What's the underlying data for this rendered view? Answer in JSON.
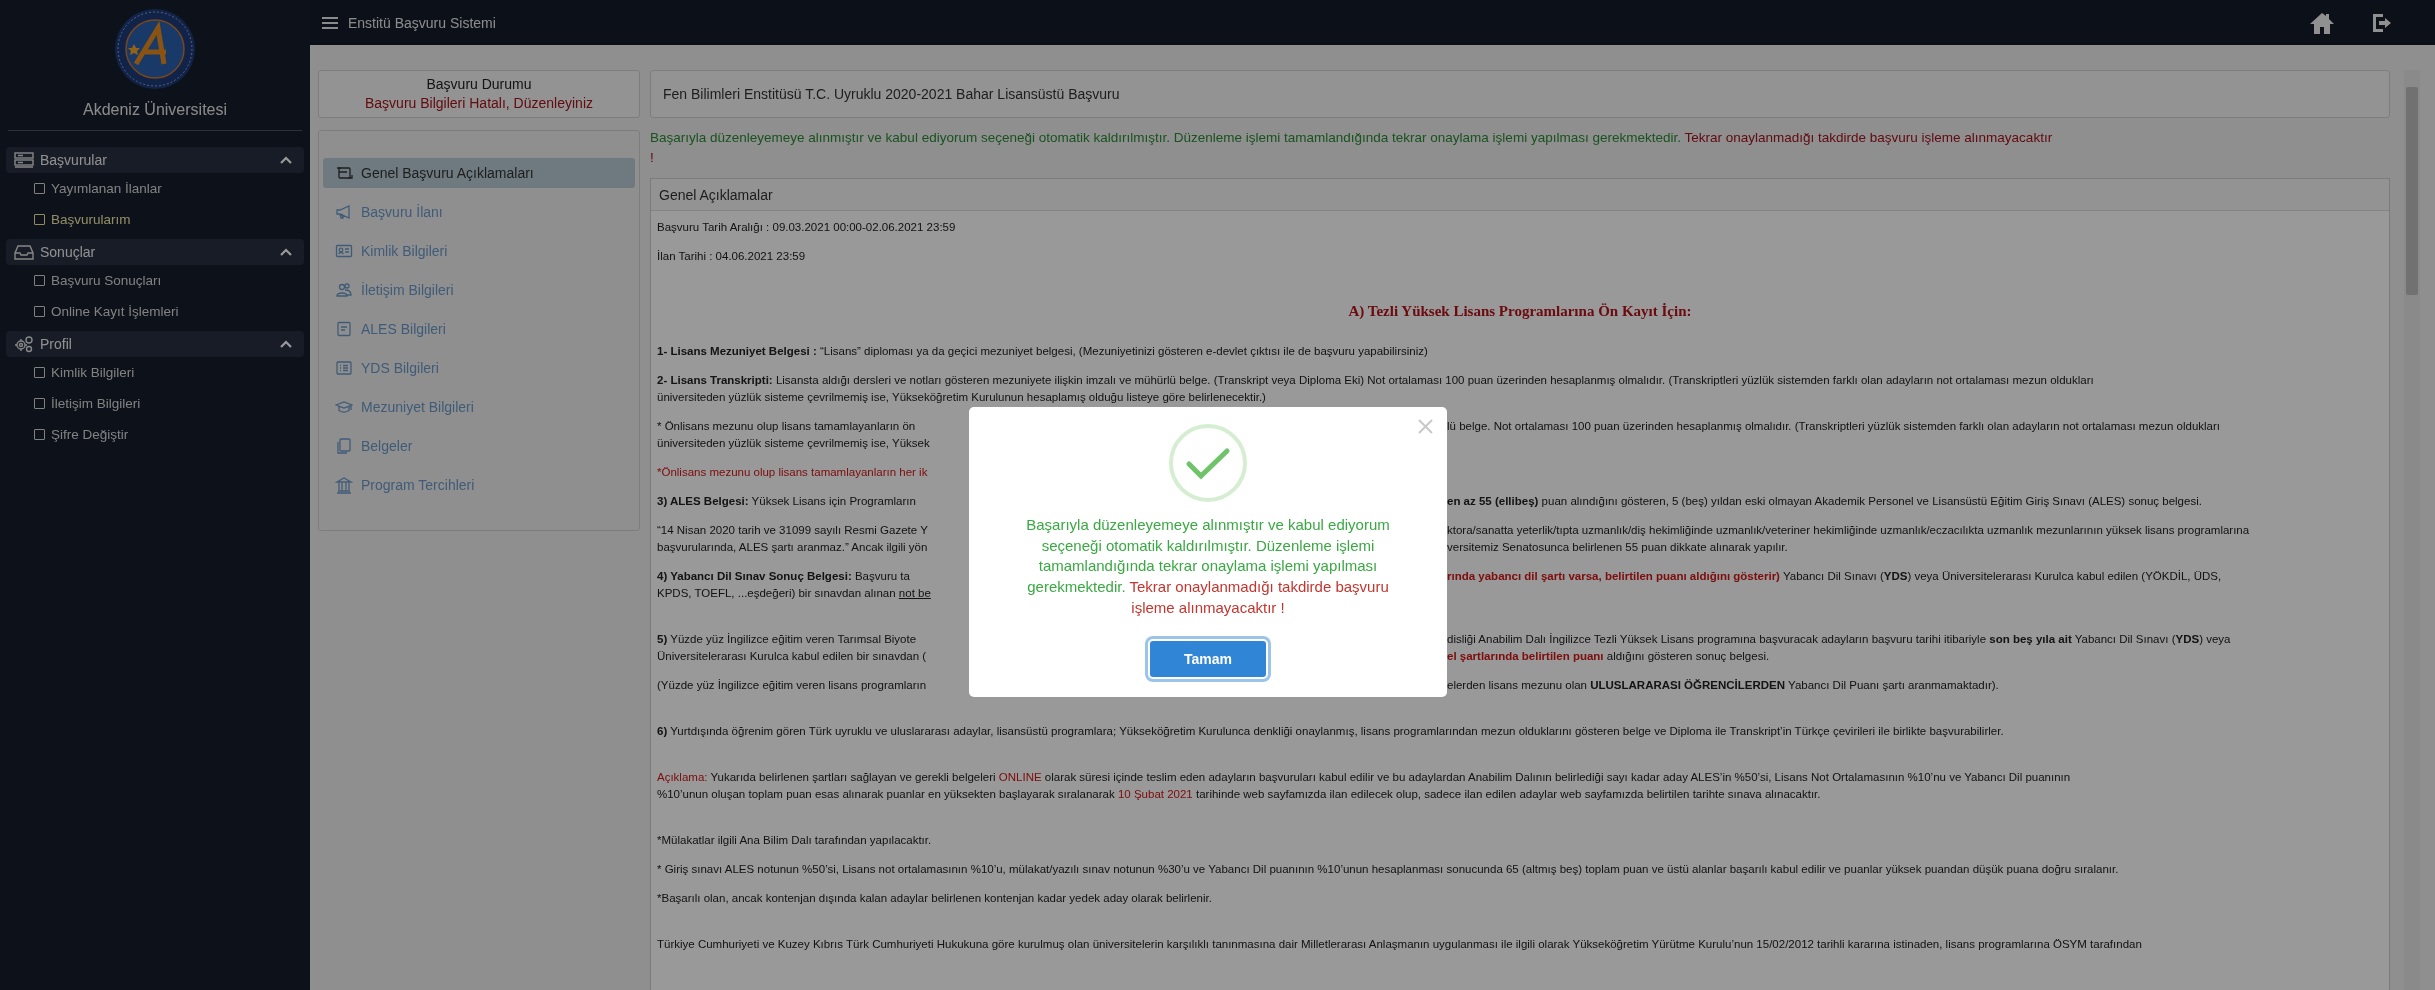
{
  "header": {
    "title": "Enstitü Başvuru Sistemi"
  },
  "sidebar": {
    "title": "Akdeniz Üniversitesi",
    "sections": [
      {
        "label": "Başvurular",
        "expanded": true,
        "items": [
          {
            "label": "Yayımlanan İlanlar",
            "selected": false
          },
          {
            "label": "Başvurularım",
            "selected": true
          }
        ]
      },
      {
        "label": "Sonuçlar",
        "expanded": true,
        "items": [
          {
            "label": "Başvuru Sonuçları",
            "selected": false
          },
          {
            "label": "Online Kayıt İşlemleri",
            "selected": false
          }
        ]
      },
      {
        "label": "Profil",
        "expanded": true,
        "items": [
          {
            "label": "Kimlik Bilgileri",
            "selected": false
          },
          {
            "label": "İletişim Bilgileri",
            "selected": false
          },
          {
            "label": "Şifre Değiştir",
            "selected": false
          }
        ]
      }
    ]
  },
  "status": {
    "title": "Başvuru Durumu",
    "message": "Başvuru Bilgileri Hatalı, Düzenleyiniz"
  },
  "menu": [
    {
      "label": "Genel Başvuru Açıklamaları",
      "selected": true
    },
    {
      "label": "Başvuru İlanı",
      "selected": false
    },
    {
      "label": "Kimlik Bilgileri",
      "selected": false
    },
    {
      "label": "İletişim Bilgileri",
      "selected": false
    },
    {
      "label": "ALES Bilgileri",
      "selected": false
    },
    {
      "label": "YDS Bilgileri",
      "selected": false
    },
    {
      "label": "Mezuniyet Bilgileri",
      "selected": false
    },
    {
      "label": "Belgeler",
      "selected": false
    },
    {
      "label": "Program Tercihleri",
      "selected": false
    }
  ],
  "content": {
    "title": "Fen Bilimleri Enstitüsü T.C. Uyruklu 2020-2021 Bahar Lisansüstü Başvuru",
    "banner": [
      [
        {
          "text": "Başarıyla düzenleyemeye alınmıştır ve kabul ediyorum seçeneği otomatik kaldırılmıştır. Düzenleme işlemi tamamlandığında tekrar onaylama işlemi yapılması gerekmektedir. ",
          "kind": "success"
        },
        {
          "text": "Tekrar onaylanmadığı takdirde başvuru işleme alınmayacaktır",
          "kind": "alert"
        }
      ],
      [
        {
          "text": "!",
          "kind": "alert"
        }
      ]
    ],
    "panel_title": "Genel Açıklamalar",
    "paragraphs": [
      {
        "kind": "text",
        "blank_line_before": false,
        "lines": [
          {
            "left": [
              {
                "text": "Başvuru Tarih Aralığı : 09.03.2021 00:00-02.06.2021 23:59",
                "kind": "normal"
              }
            ]
          }
        ]
      },
      {
        "kind": "text",
        "blank_line_before": false,
        "lines": [
          {
            "left": [
              {
                "text": "İlan Tarihi : 04.06.2021 23:59",
                "kind": "normal"
              }
            ]
          }
        ]
      },
      {
        "kind": "heading",
        "blank_line_before": false,
        "lines": [
          {
            "left": [
              {
                "text": "A) Tezli Yüksek Lisans Programlarına Ön Kayıt İçin:",
                "kind": "normal"
              }
            ]
          }
        ]
      },
      {
        "kind": "text",
        "blank_line_before": false,
        "lines": [
          {
            "left": [
              {
                "text": "**1- Lisans Mezuniyet Belgesi :** “Lisans” diploması ya da geçici mezuniyet belgesi, (Mezuniyetinizi gösteren e-devlet çıktısı ile de başvuru yapabilirsiniz)",
                "kind": "normal"
              }
            ]
          }
        ]
      },
      {
        "kind": "text",
        "blank_line_before": false,
        "lines": [
          {
            "left": [
              {
                "text": "**2- Lisans Transkripti:**   Lisansta aldığı dersleri ve notları gösteren mezuniyete ilişkin imzalı ve mühürlü belge. (Transkript veya Diploma Eki) Not ortalaması 100 puan üzerinden hesaplanmış olmalıdır. (Transkriptleri yüzlük sistemden farklı olan adayların not ortalaması mezun oldukları",
                "kind": "normal"
              }
            ]
          },
          {
            "left": [
              {
                "text": "üniversiteden yüzlük sisteme çevrilmemiş ise, Yükseköğretim Kurulunun hesaplamış olduğu listeye göre belirlenecektir.)",
                "kind": "normal"
              }
            ]
          }
        ]
      },
      {
        "kind": "text",
        "blank_line_before": false,
        "lines": [
          {
            "left": [
              {
                "text": "* Önlisans mezunu olup lisans tamamlayanların ön",
                "kind": "normal"
              }
            ],
            "right": [
              {
                "text": "lü belge. Not ortalaması 100 puan üzerinden hesaplanmış olmalıdır. (Transkriptleri yüzlük sistemden farklı olan adayların not ortalaması mezun oldukları",
                "kind": "normal"
              }
            ]
          },
          {
            "left": [
              {
                "text": "üniversiteden yüzlük sisteme çevrilmemiş ise, Yüksek",
                "kind": "normal"
              }
            ]
          }
        ]
      },
      {
        "kind": "text",
        "blank_line_before": false,
        "lines": [
          {
            "left": [
              {
                "text": "*Önlisans mezunu olup lisans tamamlayanların her ik",
                "kind": "alert"
              }
            ]
          }
        ]
      },
      {
        "kind": "text",
        "blank_line_before": false,
        "lines": [
          {
            "left": [
              {
                "text": "**3)  ALES Belgesi:** Yüksek Lisans için Programların",
                "kind": "normal"
              }
            ],
            "right": [
              {
                "text": "**en az 55 (ellibeş)** puan alındığını gösteren, 5 (beş) yıldan eski olmayan Akademik Personel ve Lisansüstü Eğitim Giriş Sınavı (ALES) sonuç belgesi.",
                "kind": "normal"
              }
            ]
          }
        ]
      },
      {
        "kind": "text",
        "blank_line_before": false,
        "lines": [
          {
            "left": [
              {
                "text": "“14 Nisan 2020 tarih ve 31099 sayılı Resmi Gazete Y",
                "kind": "normal"
              }
            ],
            "right": [
              {
                "text": "ktora/sanatta yeterlik/tıpta uzmanlık/diş hekimliğinde uzmanlık/veteriner hekimliğinde uzmanlık/eczacılıkta uzmanlık mezunlarının yüksek lisans programlarına",
                "kind": "normal"
              }
            ]
          },
          {
            "left": [
              {
                "text": "başvurularında, ALES şartı aranmaz.” Ancak ilgili yön",
                "kind": "normal"
              }
            ],
            "right": [
              {
                "text": "versitemiz Senatosunca belirlenen 55 puan dikkate alınarak yapılır.",
                "kind": "normal"
              }
            ]
          }
        ]
      },
      {
        "kind": "text",
        "blank_line_before": false,
        "lines": [
          {
            "left": [
              {
                "text": "**4) Yabancı Dil Sınav Sonuç Belgesi:** Başvuru ta",
                "kind": "normal"
              }
            ],
            "right": [
              {
                "text": "**rında yabancı dil şartı varsa, belirtilen puanı aldığını gösterir)**",
                "kind": "alert"
              },
              {
                "text": " Yabancı Dil Sınavı (**YDS**) veya Üniversitelerarası Kurulca kabul edilen (YÖKDİL, ÜDS,",
                "kind": "normal"
              }
            ]
          },
          {
            "left": [
              {
                "text": "KPDS, TOEFL, ...eşdeğeri)  bir sınavdan alınan ",
                "kind": "normal"
              },
              {
                "text": "not be",
                "kind": "underlined"
              }
            ]
          }
        ]
      },
      {
        "kind": "text",
        "blank_line_before": true,
        "lines": [
          {
            "left": [
              {
                "text": "**5)** Yüzde yüz İngilizce eğitim veren Tarımsal Biyote",
                "kind": "normal"
              }
            ],
            "right": [
              {
                "text": "disliği Anabilim Dalı İngilizce Tezli Yüksek Lisans programına başvuracak adayların başvuru tarihi itibariyle **son beş yıla ait** Yabancı Dil Sınavı (**YDS**) veya",
                "kind": "normal"
              }
            ]
          },
          {
            "left": [
              {
                "text": "Üniversitelerarası Kurulca kabul edilen bir sınavdan (",
                "kind": "normal"
              }
            ],
            "right": [
              {
                "text": "**el şartlarında belirtilen puanı**",
                "kind": "alert"
              },
              {
                "text": " aldığını gösteren sonuç belgesi.",
                "kind": "normal"
              }
            ]
          }
        ]
      },
      {
        "kind": "text",
        "blank_line_before": false,
        "lines": [
          {
            "left": [
              {
                "text": "(Yüzde yüz İngilizce eğitim veren lisans programların",
                "kind": "normal"
              }
            ],
            "right": [
              {
                "text": "elerden lisans mezunu olan **ULUSLARARASI ÖĞRENCİLERDEN** Yabancı Dil Puanı şartı aranmamaktadır).",
                "kind": "normal"
              }
            ]
          }
        ]
      },
      {
        "kind": "text",
        "blank_line_before": true,
        "lines": [
          {
            "left": [
              {
                "text": "**6)** Yurtdışında öğrenim gören Türk uyruklu ve uluslararası adaylar, lisansüstü programlara; Yükseköğretim Kurulunca denkliği onaylanmış, lisans programlarından mezun olduklarını gösteren belge ve Diploma ile Transkript’in Türkçe çevirileri ile birlikte başvurabilirler.",
                "kind": "normal"
              }
            ]
          }
        ]
      },
      {
        "kind": "text",
        "blank_line_before": true,
        "lines": [
          {
            "left": [
              {
                "text": "Açıklama:",
                "kind": "alert"
              },
              {
                "text": " Yukarıda belirlenen şartları sağlayan ve gerekli belgeleri ",
                "kind": "normal"
              },
              {
                "text": "ONLINE",
                "kind": "alert"
              },
              {
                "text": " olarak süresi içinde teslim eden adayların başvuruları kabul edilir ve bu adaylardan Anabilim Dalının belirlediği sayı kadar aday ALES’in %50’si, Lisans Not Ortalamasının %10’nu ve Yabancı Dil puanının",
                "kind": "normal"
              }
            ]
          },
          {
            "left": [
              {
                "text": "%10’unun oluşan toplam puan esas alınarak puanlar en yüksekten başlayarak sıralanarak ",
                "kind": "normal"
              },
              {
                "text": "10 Şubat 2021",
                "kind": "alert"
              },
              {
                "text": " tarihinde web sayfamızda ilan edilecek olup, sadece ilan edilen adaylar web sayfamızda belirtilen tarihte sınava alınacaktır.",
                "kind": "normal"
              }
            ]
          }
        ]
      },
      {
        "kind": "text",
        "blank_line_before": true,
        "lines": [
          {
            "left": [
              {
                "text": "*Mülakatlar ilgili Ana Bilim Dalı tarafından yapılacaktır.",
                "kind": "normal"
              }
            ]
          }
        ]
      },
      {
        "kind": "text",
        "blank_line_before": false,
        "lines": [
          {
            "left": [
              {
                "text": "* Giriş sınavı ALES notunun %50’si, Lisans not ortalamasının %10’u, mülakat/yazılı sınav notunun %30’u ve Yabancı Dil puanının %10’unun hesaplanması sonucunda 65 (altmış beş) toplam puan ve üstü alanlar başarılı kabul edilir ve puanlar yüksek puandan düşük puana doğru sıralanır.",
                "kind": "normal"
              }
            ]
          }
        ]
      },
      {
        "kind": "text",
        "blank_line_before": false,
        "lines": [
          {
            "left": [
              {
                "text": "*Başarılı olan, ancak kontenjan dışında kalan adaylar belirlenen kontenjan kadar yedek aday olarak belirlenir.",
                "kind": "normal"
              }
            ]
          }
        ]
      },
      {
        "kind": "text",
        "blank_line_before": true,
        "lines": [
          {
            "left": [
              {
                "text": "Türkiye Cumhuriyeti ve Kuzey Kıbrıs Türk Cumhuriyeti Hukukuna göre kurulmuş olan üniversitelerin karşılıklı tanınmasına dair Milletlerarası Anlaşmanın uygulanması ile ilgili olarak Yükseköğretim Yürütme Kurulu’nun 15/02/2012 tarihli kararına istinaden, lisans programlarına ÖSYM tarafından",
                "kind": "normal"
              }
            ]
          }
        ]
      }
    ]
  },
  "modal": {
    "message": [
      {
        "text": "Başarıyla düzenleyemeye alınmıştır ve kabul ediyorum seçeneği otomatik kaldırılmıştır. Düzenleme işlemi tamamlandığında tekrar onaylama işlemi yapılması gerekmektedir. ",
        "kind": "success"
      },
      {
        "text": "Tekrar onaylanmadığı takdirde başvuru işleme alınmayacaktır !",
        "kind": "alert"
      }
    ],
    "button": "Tamam"
  }
}
